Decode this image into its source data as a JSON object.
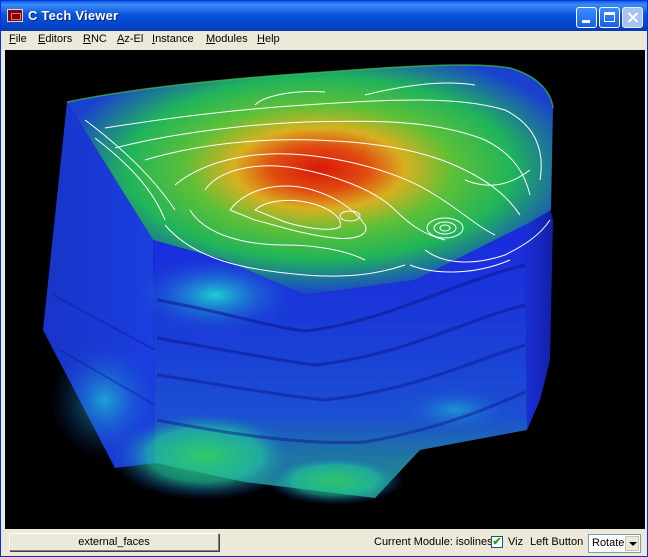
{
  "window": {
    "title": "C Tech Viewer"
  },
  "menu": [
    {
      "label": "File",
      "accel": "F",
      "rest": "ile"
    },
    {
      "label": "Editors",
      "accel": "E",
      "rest": "ditors"
    },
    {
      "label": "RNC",
      "accel": "R",
      "rest": "NC"
    },
    {
      "label": "Az-El",
      "accel": "A",
      "rest": "z-El"
    },
    {
      "label": "Instance",
      "accel": "I",
      "rest": "nstance"
    },
    {
      "label": "Modules",
      "accel": "M",
      "rest": "odules"
    },
    {
      "label": "Help",
      "accel": "H",
      "rest": "elp"
    }
  ],
  "status": {
    "active_object": "external_faces",
    "current_module": "Current Module: isolines",
    "viz_label": "Viz",
    "viz_checked": true,
    "left_button_label": "Left Button",
    "mode": "Rotate"
  },
  "icons": {
    "app": "ctech-app-icon",
    "minimize": "minimize-icon",
    "maximize": "maximize-icon",
    "close": "close-icon",
    "dropdown": "chevron-down-icon",
    "check": "checkmark-icon"
  },
  "colors": {
    "titlebar": "#0a54de",
    "viewport_background": "#000000",
    "surface_low": "#1a22d0",
    "surface_mid": "#18c048",
    "surface_high": "#d81808",
    "isolines": "#ffffff"
  }
}
